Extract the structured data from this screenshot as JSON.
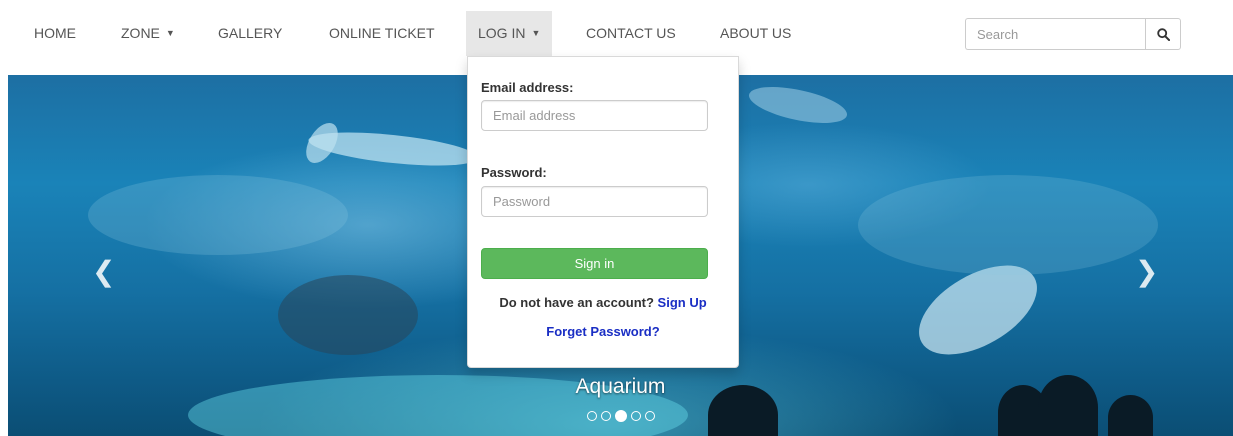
{
  "nav": {
    "items": [
      {
        "label": "HOME"
      },
      {
        "label": "ZONE"
      },
      {
        "label": "GALLERY"
      },
      {
        "label": "ONLINE TICKET"
      },
      {
        "label": "LOG IN"
      },
      {
        "label": "CONTACT US"
      },
      {
        "label": "ABOUT US"
      }
    ],
    "active_item": "LOG IN"
  },
  "search": {
    "placeholder": "Search",
    "button_icon": "search-icon"
  },
  "login_dropdown": {
    "email_label": "Email address:",
    "email_placeholder": "Email address",
    "password_label": "Password:",
    "password_placeholder": "Password",
    "sign_in_label": "Sign in",
    "no_account_text": "Do not have an account?",
    "sign_up_label": "Sign Up",
    "forget_password_label": "Forget Password?"
  },
  "carousel": {
    "caption": "Aquarium",
    "slide_count": 5,
    "active_index": 2,
    "prev_icon": "chevron-left-icon",
    "next_icon": "chevron-right-icon"
  },
  "colors": {
    "success_green": "#5cb85c",
    "link_blue": "#1a2ec4",
    "active_nav_bg": "#e7e7e7"
  }
}
